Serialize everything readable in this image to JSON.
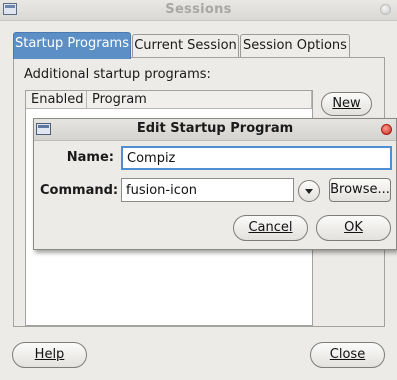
{
  "window": {
    "title": "Sessions"
  },
  "tabs": [
    {
      "label": "Startup Programs",
      "active": true
    },
    {
      "label": "Current Session",
      "active": false
    },
    {
      "label": "Session Options",
      "active": false
    }
  ],
  "startup": {
    "label": "Additional startup programs:",
    "columns": [
      "Enabled",
      "Program"
    ],
    "new_button": "New"
  },
  "footer": {
    "help_button": "Help",
    "close_button": "Close"
  },
  "dialog": {
    "title": "Edit Startup Program",
    "name_label": "Name:",
    "name_value": "Compiz",
    "command_label": "Command:",
    "command_value": "fusion-icon",
    "browse_button": "Browse...",
    "cancel_button": "Cancel",
    "ok_button": "OK"
  }
}
